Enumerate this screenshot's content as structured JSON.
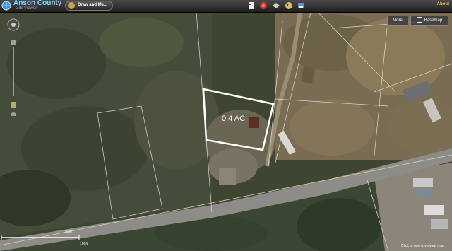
{
  "app": {
    "title": "Anson County",
    "subtitle": "GIS Viewer"
  },
  "toolbar": {
    "draw_label": "Draw and Me...",
    "about_label": "About"
  },
  "map_controls": {
    "more_label": "More",
    "basemap_label": "Basemap"
  },
  "parcel": {
    "area_label": "0.4 AC"
  },
  "scale": {
    "top_label": "50m",
    "bottom_label": "100ft"
  },
  "footer": {
    "credit": "Click to open overview map"
  },
  "colors": {
    "title": "#7fd1ff",
    "about": "#f0c040",
    "parcel_outline": "#ffffff"
  }
}
